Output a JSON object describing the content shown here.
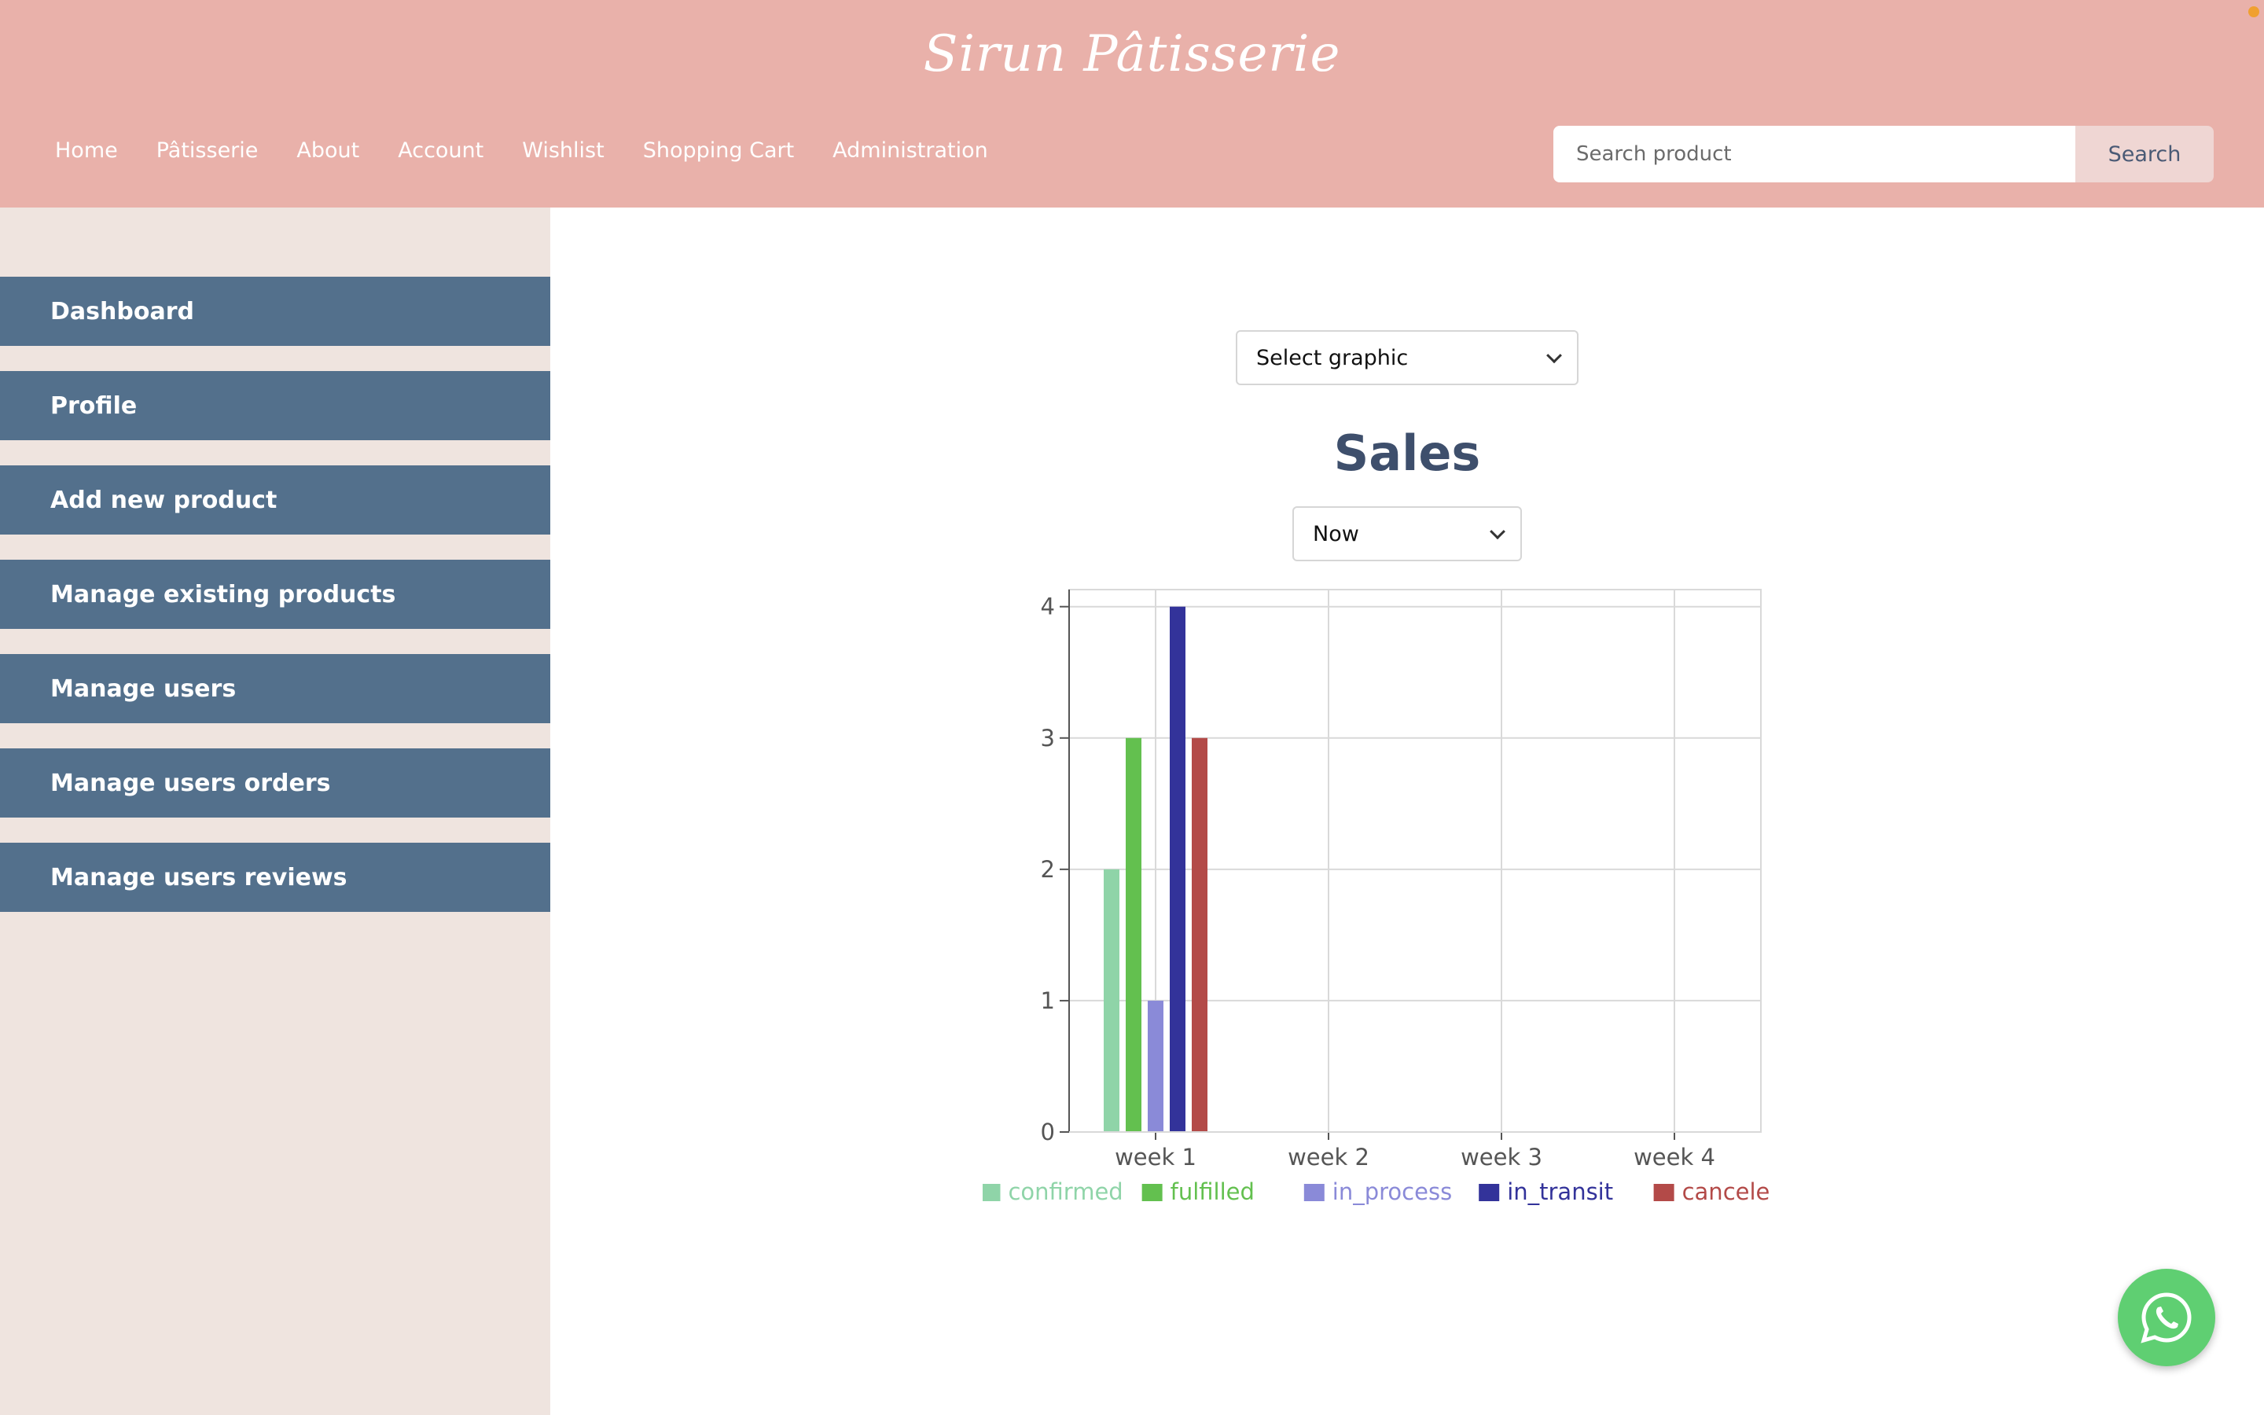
{
  "header": {
    "brand": "Sirun Pâtisserie",
    "nav": [
      "Home",
      "Pâtisserie",
      "About",
      "Account",
      "Wishlist",
      "Shopping Cart",
      "Administration"
    ],
    "search": {
      "placeholder": "Search product",
      "button_label": "Search"
    }
  },
  "sidebar": {
    "items": [
      {
        "label": "Dashboard"
      },
      {
        "label": "Profile"
      },
      {
        "label": "Add new product"
      },
      {
        "label": "Manage existing products"
      },
      {
        "label": "Manage users"
      },
      {
        "label": "Manage users orders"
      },
      {
        "label": "Manage users reviews"
      }
    ]
  },
  "main": {
    "graphic_select": {
      "value": "Select graphic"
    },
    "period_select": {
      "value": "Now"
    }
  },
  "colors": {
    "header_bg": "#e9b1aa",
    "sidebar_bg": "#efe4df",
    "sidebar_button": "#53708c",
    "title": "#3e4f6c"
  },
  "icons": {
    "whatsapp_button": "whatsapp-icon",
    "select_caret": "chevron-down-icon"
  },
  "chart_data": {
    "type": "bar",
    "title": "Sales",
    "categories": [
      "week 1",
      "week 2",
      "week 3",
      "week 4"
    ],
    "series": [
      {
        "name": "confirmed",
        "color": "#8fd4a8",
        "values": [
          2,
          0,
          0,
          0
        ]
      },
      {
        "name": "fulfilled",
        "color": "#63c04f",
        "values": [
          3,
          0,
          0,
          0
        ]
      },
      {
        "name": "in_process",
        "color": "#8a8ad8",
        "values": [
          1,
          0,
          0,
          0
        ]
      },
      {
        "name": "in_transit",
        "color": "#33339a",
        "values": [
          4,
          0,
          0,
          0
        ]
      },
      {
        "name": "canceled",
        "color": "#b34a48",
        "values": [
          3,
          0,
          0,
          0
        ]
      }
    ],
    "yticks": [
      "0",
      "1",
      "2",
      "3",
      "4"
    ],
    "ylim": [
      0,
      4.13
    ],
    "grid": true,
    "legend": "bottom"
  }
}
